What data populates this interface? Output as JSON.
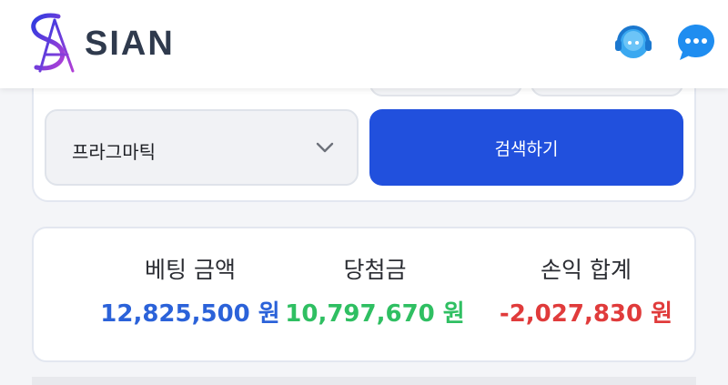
{
  "header": {
    "brand": "SIAN",
    "icons": [
      "support-agent-icon",
      "chat-bubble-icon"
    ]
  },
  "filter": {
    "type_select": {
      "value": "프라그마틱"
    },
    "search_button_label": "검색하기"
  },
  "summary": {
    "betting": {
      "label": "베팅 금액",
      "value": "12,825,500 원",
      "color": "#2b62d9"
    },
    "winnings": {
      "label": "당첨금",
      "value": "10,797,670 원",
      "color": "#2fbf62"
    },
    "profit": {
      "label": "손익 합계",
      "value": "-2,027,830 원",
      "color": "#e03b3b"
    }
  },
  "colors": {
    "accent": "#2150dd",
    "brand_text": "#2f3a4d",
    "logo_gradient_start": "#2c3be0",
    "logo_gradient_end": "#b13fd6"
  }
}
